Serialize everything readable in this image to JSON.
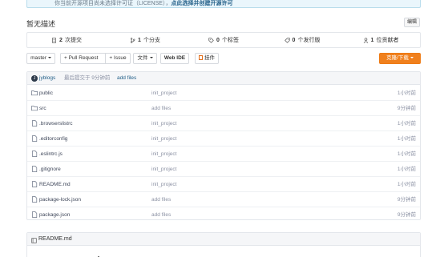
{
  "notice": {
    "text": "你当前开源项目尚未选择许可证（LICENSE），",
    "link": "点此选择并创建开源许可"
  },
  "description": {
    "title": "暂无描述",
    "edit_label": "编辑"
  },
  "stats": [
    {
      "icon": "commit-icon",
      "count": "2",
      "label": "次提交"
    },
    {
      "icon": "branch-icon",
      "count": "1",
      "label": "个分支"
    },
    {
      "icon": "tag-icon",
      "count": "0",
      "label": "个标签"
    },
    {
      "icon": "release-icon",
      "count": "0",
      "label": "个发行版"
    },
    {
      "icon": "contributor-icon",
      "count": "1",
      "label": "位贡献者"
    }
  ],
  "toolbar": {
    "branch": "master",
    "pull_request": "+ Pull Request",
    "issue": "+ Issue",
    "file": "文件",
    "web_ide": "Web IDE",
    "widget": "挂件",
    "clone": "克隆/下载"
  },
  "last_commit": {
    "avatar_letter": "J",
    "user": "jyblogs",
    "meta": "最后提交于 9分钟前",
    "message": "add files"
  },
  "files": [
    {
      "type": "folder",
      "name": "public",
      "message": "init_project",
      "time": "1小时前"
    },
    {
      "type": "folder",
      "name": "src",
      "message": "add files",
      "time": "9分钟前"
    },
    {
      "type": "file",
      "name": ".browserslistrc",
      "message": "init_project",
      "time": "1小时前"
    },
    {
      "type": "file",
      "name": ".editorconfig",
      "message": "init_project",
      "time": "1小时前"
    },
    {
      "type": "file",
      "name": ".eslintrc.js",
      "message": "init_project",
      "time": "1小时前"
    },
    {
      "type": "file",
      "name": ".gitignore",
      "message": "init_project",
      "time": "1小时前"
    },
    {
      "type": "file",
      "name": "README.md",
      "message": "init_project",
      "time": "1小时前"
    },
    {
      "type": "file",
      "name": "package-lock.json",
      "message": "add files",
      "time": "9分钟前"
    },
    {
      "type": "file",
      "name": "package.json",
      "message": "add files",
      "time": "9分钟前"
    }
  ],
  "readme": {
    "title": "README.md"
  },
  "colors": {
    "accent": "#f0801d",
    "link": "#1f5d87",
    "muted": "#8c92a4"
  }
}
